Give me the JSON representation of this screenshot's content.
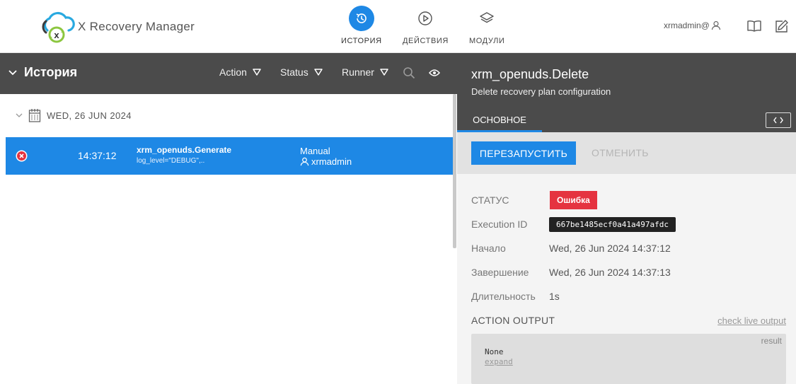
{
  "app": {
    "name": "X Recovery Manager"
  },
  "nav": [
    {
      "label": "ИСТОРИЯ",
      "icon": "history-icon",
      "active": true
    },
    {
      "label": "ДЕЙСТВИЯ",
      "icon": "play-icon",
      "active": false
    },
    {
      "label": "МОДУЛИ",
      "icon": "layers-icon",
      "active": false
    }
  ],
  "header": {
    "user": "xrmadmin@"
  },
  "history": {
    "title": "История",
    "filters": [
      "Action",
      "Status",
      "Runner"
    ],
    "date_group": "WED, 26 JUN 2024",
    "executions": [
      {
        "time": "14:37:12",
        "action": "xrm_openuds.Generate",
        "params": "log_level=\"DEBUG\",..",
        "trigger": "Manual",
        "runner": "xrmadmin",
        "status": "failed"
      }
    ]
  },
  "detail": {
    "title": "xrm_openuds.Delete",
    "description": "Delete recovery plan configuration",
    "tab": "ОСНОВНОЕ",
    "rerun_label": "ПЕРЕЗАПУСТИТЬ",
    "cancel_label": "ОТМЕНИТЬ",
    "fields": {
      "status_label": "СТАТУС",
      "status_value": "Ошибка",
      "exec_id_label": "Execution ID",
      "exec_id_value": "667be1485ecf0a41a497afdc",
      "start_label": "Начало",
      "start_value": "Wed, 26 Jun 2024 14:37:12",
      "end_label": "Завершение",
      "end_value": "Wed, 26 Jun 2024 14:37:13",
      "duration_label": "Длительность",
      "duration_value": "1s"
    },
    "output": {
      "title": "ACTION OUTPUT",
      "live_link": "check live output",
      "result_label": "result",
      "value": "None",
      "expand_label": "expand"
    }
  },
  "colors": {
    "accent": "#1e88e5",
    "toolbar": "#4b4b4b",
    "error": "#e53340"
  }
}
